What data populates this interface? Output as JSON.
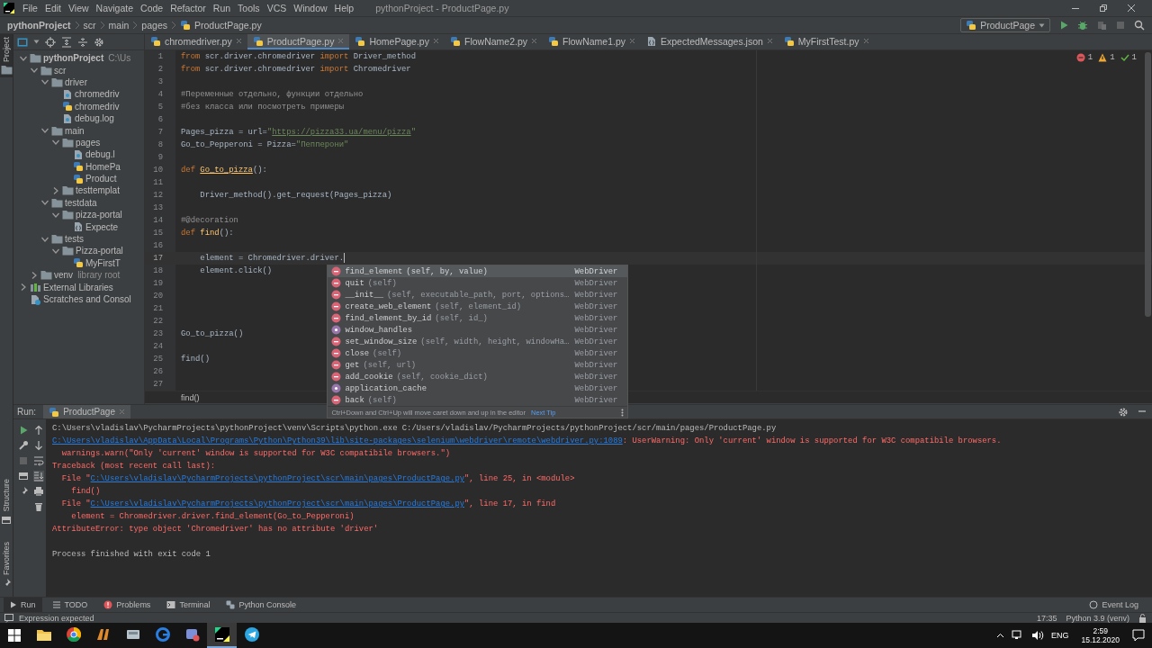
{
  "window": {
    "title": "pythonProject - ProductPage.py"
  },
  "menu": [
    "File",
    "Edit",
    "View",
    "Navigate",
    "Code",
    "Refactor",
    "Run",
    "Tools",
    "VCS",
    "Window",
    "Help"
  ],
  "breadcrumbs": {
    "project": "pythonProject",
    "folders": [
      "scr",
      "main",
      "pages"
    ],
    "file": "ProductPage.py"
  },
  "run_config": {
    "label": "ProductPage"
  },
  "left_strip": {
    "top": [
      {
        "label": "Project",
        "selected": true
      }
    ],
    "bottom": [
      {
        "label": "Structure",
        "selected": false
      },
      {
        "label": "Favorites",
        "selected": false
      }
    ]
  },
  "project_tree": [
    {
      "label": "pythonProject",
      "kind": "folder",
      "expanded": true,
      "hint": "C:\\Us",
      "children": [
        {
          "label": "scr",
          "kind": "folder",
          "expanded": true,
          "children": [
            {
              "label": "driver",
              "kind": "folder",
              "expanded": true,
              "children": [
                {
                  "label": "chromedriv",
                  "kind": "text"
                },
                {
                  "label": "chromedriv",
                  "kind": "python"
                },
                {
                  "label": "debug.log",
                  "kind": "text"
                }
              ]
            },
            {
              "label": "main",
              "kind": "folder",
              "expanded": true,
              "children": [
                {
                  "label": "pages",
                  "kind": "folder",
                  "expanded": true,
                  "children": [
                    {
                      "label": "debug.l",
                      "kind": "text"
                    },
                    {
                      "label": "HomePa",
                      "kind": "python"
                    },
                    {
                      "label": "Product",
                      "kind": "python"
                    }
                  ]
                },
                {
                  "label": "testtemplat",
                  "kind": "folder",
                  "expanded": false
                }
              ]
            },
            {
              "label": "testdata",
              "kind": "folder",
              "expanded": true,
              "children": [
                {
                  "label": "pizza-portal",
                  "kind": "folder",
                  "expanded": true,
                  "children": [
                    {
                      "label": "Expecte",
                      "kind": "json"
                    }
                  ]
                }
              ]
            },
            {
              "label": "tests",
              "kind": "folder",
              "expanded": true,
              "children": [
                {
                  "label": "Pizza-portal",
                  "kind": "folder",
                  "expanded": true,
                  "children": [
                    {
                      "label": "MyFirstT",
                      "kind": "python"
                    }
                  ]
                }
              ]
            }
          ]
        },
        {
          "label": "venv",
          "kind": "folder",
          "expanded": false,
          "hint": "library root"
        }
      ]
    },
    {
      "label": "External Libraries",
      "kind": "library",
      "expanded": false
    },
    {
      "label": "Scratches and Consol",
      "kind": "scratch"
    }
  ],
  "editor": {
    "tabs": [
      {
        "label": "chromedriver.py",
        "kind": "python",
        "selected": false
      },
      {
        "label": "ProductPage.py",
        "kind": "python",
        "selected": true
      },
      {
        "label": "HomePage.py",
        "kind": "python",
        "selected": false
      },
      {
        "label": "FlowName2.py",
        "kind": "python",
        "selected": false
      },
      {
        "label": "FlowName1.py",
        "kind": "python",
        "selected": false
      },
      {
        "label": "ExpectedMessages.json",
        "kind": "json",
        "selected": false
      },
      {
        "label": "MyFirstTest.py",
        "kind": "python",
        "selected": false
      }
    ],
    "inspections": [
      {
        "kind": "error",
        "count": "1"
      },
      {
        "kind": "warning",
        "count": "1"
      },
      {
        "kind": "ok",
        "count": "1"
      }
    ],
    "lines": [
      {
        "number": "1",
        "current": false,
        "tokens": [
          {
            "kind": "keyword",
            "text": "from"
          },
          {
            "kind": "text",
            "text": " scr.driver.chromedriver "
          },
          {
            "kind": "keyword",
            "text": "import"
          },
          {
            "kind": "text",
            "text": " Driver_method"
          }
        ]
      },
      {
        "number": "2",
        "current": false,
        "tokens": [
          {
            "kind": "keyword",
            "text": "from"
          },
          {
            "kind": "text",
            "text": " scr.driver.chromedriver "
          },
          {
            "kind": "keyword",
            "text": "import"
          },
          {
            "kind": "text",
            "text": " Chromedriver"
          }
        ]
      },
      {
        "number": "3",
        "current": false
      },
      {
        "number": "4",
        "current": false,
        "tokens": [
          {
            "kind": "comment",
            "text": "#Переменные отдельно, функции отдельно"
          }
        ]
      },
      {
        "number": "5",
        "current": false,
        "tokens": [
          {
            "kind": "comment",
            "text": "#без класса или посмотреть примеры"
          }
        ]
      },
      {
        "number": "6",
        "current": false
      },
      {
        "number": "7",
        "current": false,
        "tokens": [
          {
            "kind": "text",
            "text": "Pages_pizza = url="
          },
          {
            "kind": "string",
            "text": "\""
          },
          {
            "kind": "link",
            "text": "https://pizza33.ua/menu/pizza"
          },
          {
            "kind": "string",
            "text": "\""
          }
        ]
      },
      {
        "number": "8",
        "current": false,
        "tokens": [
          {
            "kind": "text",
            "text": "Go_to_Pepperoni = Pizza="
          },
          {
            "kind": "string",
            "text": "\"Пепперони\""
          }
        ]
      },
      {
        "number": "9",
        "current": false
      },
      {
        "number": "10",
        "current": false,
        "tokens": [
          {
            "kind": "keyword",
            "text": "def "
          },
          {
            "kind": "warned_function",
            "text": "Go_to_pizza"
          },
          {
            "kind": "text",
            "text": "():"
          }
        ]
      },
      {
        "number": "11",
        "current": false
      },
      {
        "number": "12",
        "current": false,
        "tokens": [
          {
            "kind": "text",
            "text": "    Driver_method().get_request(Pages_pizza)"
          }
        ]
      },
      {
        "number": "13",
        "current": false
      },
      {
        "number": "14",
        "current": false,
        "tokens": [
          {
            "kind": "comment",
            "text": "#@decoration"
          }
        ]
      },
      {
        "number": "15",
        "current": false,
        "tokens": [
          {
            "kind": "keyword",
            "text": "def "
          },
          {
            "kind": "function",
            "text": "find"
          },
          {
            "kind": "text",
            "text": "():"
          }
        ]
      },
      {
        "number": "16",
        "current": false
      },
      {
        "number": "17",
        "current": true,
        "tokens": [
          {
            "kind": "text",
            "text": "    element = Chromedriver.driver."
          }
        ]
      },
      {
        "number": "18",
        "current": false,
        "tokens": [
          {
            "kind": "text",
            "text": "    element.click()"
          }
        ]
      },
      {
        "number": "19",
        "current": false
      },
      {
        "number": "20",
        "current": false
      },
      {
        "number": "21",
        "current": false
      },
      {
        "number": "22",
        "current": false
      },
      {
        "number": "23",
        "current": false,
        "tokens": [
          {
            "kind": "text",
            "text": "Go_to_pizza()"
          }
        ]
      },
      {
        "number": "24",
        "current": false
      },
      {
        "number": "25",
        "current": false,
        "tokens": [
          {
            "kind": "text",
            "text": "find()"
          }
        ]
      },
      {
        "number": "26",
        "current": false
      },
      {
        "number": "27",
        "current": false
      }
    ],
    "completion": {
      "items": [
        {
          "kind": "method",
          "name": "find_element",
          "params": "(self, by, value)",
          "type": "WebDriver",
          "selected": true
        },
        {
          "kind": "method",
          "name": "quit",
          "params": "(self)",
          "type": "WebDriver",
          "selected": false
        },
        {
          "kind": "method",
          "name": "__init__",
          "params": "(self, executable_path, port, options…",
          "type": "WebDriver",
          "selected": false
        },
        {
          "kind": "method",
          "name": "create_web_element",
          "params": "(self, element_id)",
          "type": "WebDriver",
          "selected": false
        },
        {
          "kind": "method",
          "name": "find_element_by_id",
          "params": "(self, id_)",
          "type": "WebDriver",
          "selected": false
        },
        {
          "kind": "property",
          "name": "window_handles",
          "type": "WebDriver",
          "selected": false
        },
        {
          "kind": "method",
          "name": "set_window_size",
          "params": "(self, width, height, windowHa…",
          "type": "WebDriver",
          "selected": false
        },
        {
          "kind": "method",
          "name": "close",
          "params": "(self)",
          "type": "WebDriver",
          "selected": false
        },
        {
          "kind": "method",
          "name": "get",
          "params": "(self, url)",
          "type": "WebDriver",
          "selected": false
        },
        {
          "kind": "method",
          "name": "add_cookie",
          "params": "(self, cookie_dict)",
          "type": "WebDriver",
          "selected": false
        },
        {
          "kind": "property",
          "name": "application_cache",
          "type": "WebDriver",
          "selected": false
        },
        {
          "kind": "method",
          "name": "back",
          "params": "(self)",
          "type": "WebDriver",
          "selected": false
        }
      ],
      "hint": "Ctrl+Down and Ctrl+Up will move caret down and up in the editor",
      "hint_link": "Next Tip"
    },
    "breadcrumb": "find()"
  },
  "run_panel": {
    "label": "Run:",
    "tab": "ProductPage",
    "console": [
      {
        "kind": "text",
        "segments": [
          {
            "kind": "output",
            "text": "C:\\Users\\vladislav\\PycharmProjects\\pythonProject\\venv\\Scripts\\python.exe C:/Users/vladislav/PycharmProjects/pythonProject/scr/main/pages/ProductPage.py"
          }
        ]
      },
      {
        "kind": "text",
        "segments": [
          {
            "kind": "link",
            "text": "C:\\Users\\vladislav\\AppData\\Local\\Programs\\Python\\Python39\\lib\\site-packages\\selenium\\webdriver\\remote\\webdriver.py:1089"
          },
          {
            "kind": "error",
            "text": ": UserWarning: Only 'current' window is supported for W3C compatibile browsers."
          }
        ]
      },
      {
        "kind": "text",
        "segments": [
          {
            "kind": "error",
            "text": "  warnings.warn(\"Only 'current' window is supported for W3C compatibile browsers.\")"
          }
        ]
      },
      {
        "kind": "text",
        "segments": [
          {
            "kind": "error",
            "text": "Traceback (most recent call last):"
          }
        ]
      },
      {
        "kind": "text",
        "segments": [
          {
            "kind": "error",
            "text": "  File \""
          },
          {
            "kind": "link",
            "text": "C:\\Users\\vladislav\\PycharmProjects\\pythonProject\\scr\\main\\pages\\ProductPage.py"
          },
          {
            "kind": "error",
            "text": "\", line 25, in <module>"
          }
        ]
      },
      {
        "kind": "text",
        "segments": [
          {
            "kind": "error",
            "text": "    find()"
          }
        ]
      },
      {
        "kind": "text",
        "segments": [
          {
            "kind": "error",
            "text": "  File \""
          },
          {
            "kind": "link",
            "text": "C:\\Users\\vladislav\\PycharmProjects\\pythonProject\\scr\\main\\pages\\ProductPage.py"
          },
          {
            "kind": "error",
            "text": "\", line 17, in find"
          }
        ]
      },
      {
        "kind": "text",
        "segments": [
          {
            "kind": "error",
            "text": "    element = Chromedriver.driver.find_element(Go_to_Pepperoni)"
          }
        ]
      },
      {
        "kind": "text",
        "segments": [
          {
            "kind": "error",
            "text": "AttributeError: type object 'Chromedriver' has no attribute 'driver'"
          }
        ]
      },
      {
        "kind": "blank"
      },
      {
        "kind": "text",
        "segments": [
          {
            "kind": "output",
            "text": "Process finished with exit code 1"
          }
        ]
      }
    ]
  },
  "tool_tabs": [
    {
      "label": "Run",
      "kind": "run",
      "selected": true
    },
    {
      "label": "TODO",
      "kind": "todo",
      "selected": false
    },
    {
      "label": "Problems",
      "kind": "problems",
      "selected": false
    },
    {
      "label": "Terminal",
      "kind": "terminal",
      "selected": false
    },
    {
      "label": "Python Console",
      "kind": "console",
      "selected": false
    }
  ],
  "event_log": "Event Log",
  "status_bar": {
    "message": "Expression expected",
    "position": "17:35",
    "interpreter": "Python 3.9 (venv)"
  },
  "taskbar": {
    "apps": [
      {
        "kind": "folder",
        "selected": false
      },
      {
        "kind": "ball",
        "selected": false
      },
      {
        "kind": "game",
        "selected": false
      },
      {
        "kind": "disk",
        "selected": false
      },
      {
        "kind": "ring",
        "selected": false
      },
      {
        "kind": "mail",
        "selected": false
      },
      {
        "kind": "ide",
        "selected": true
      },
      {
        "kind": "messenger",
        "selected": false
      }
    ],
    "language": "ENG",
    "time": "2:59",
    "date": "15.12.2020"
  }
}
